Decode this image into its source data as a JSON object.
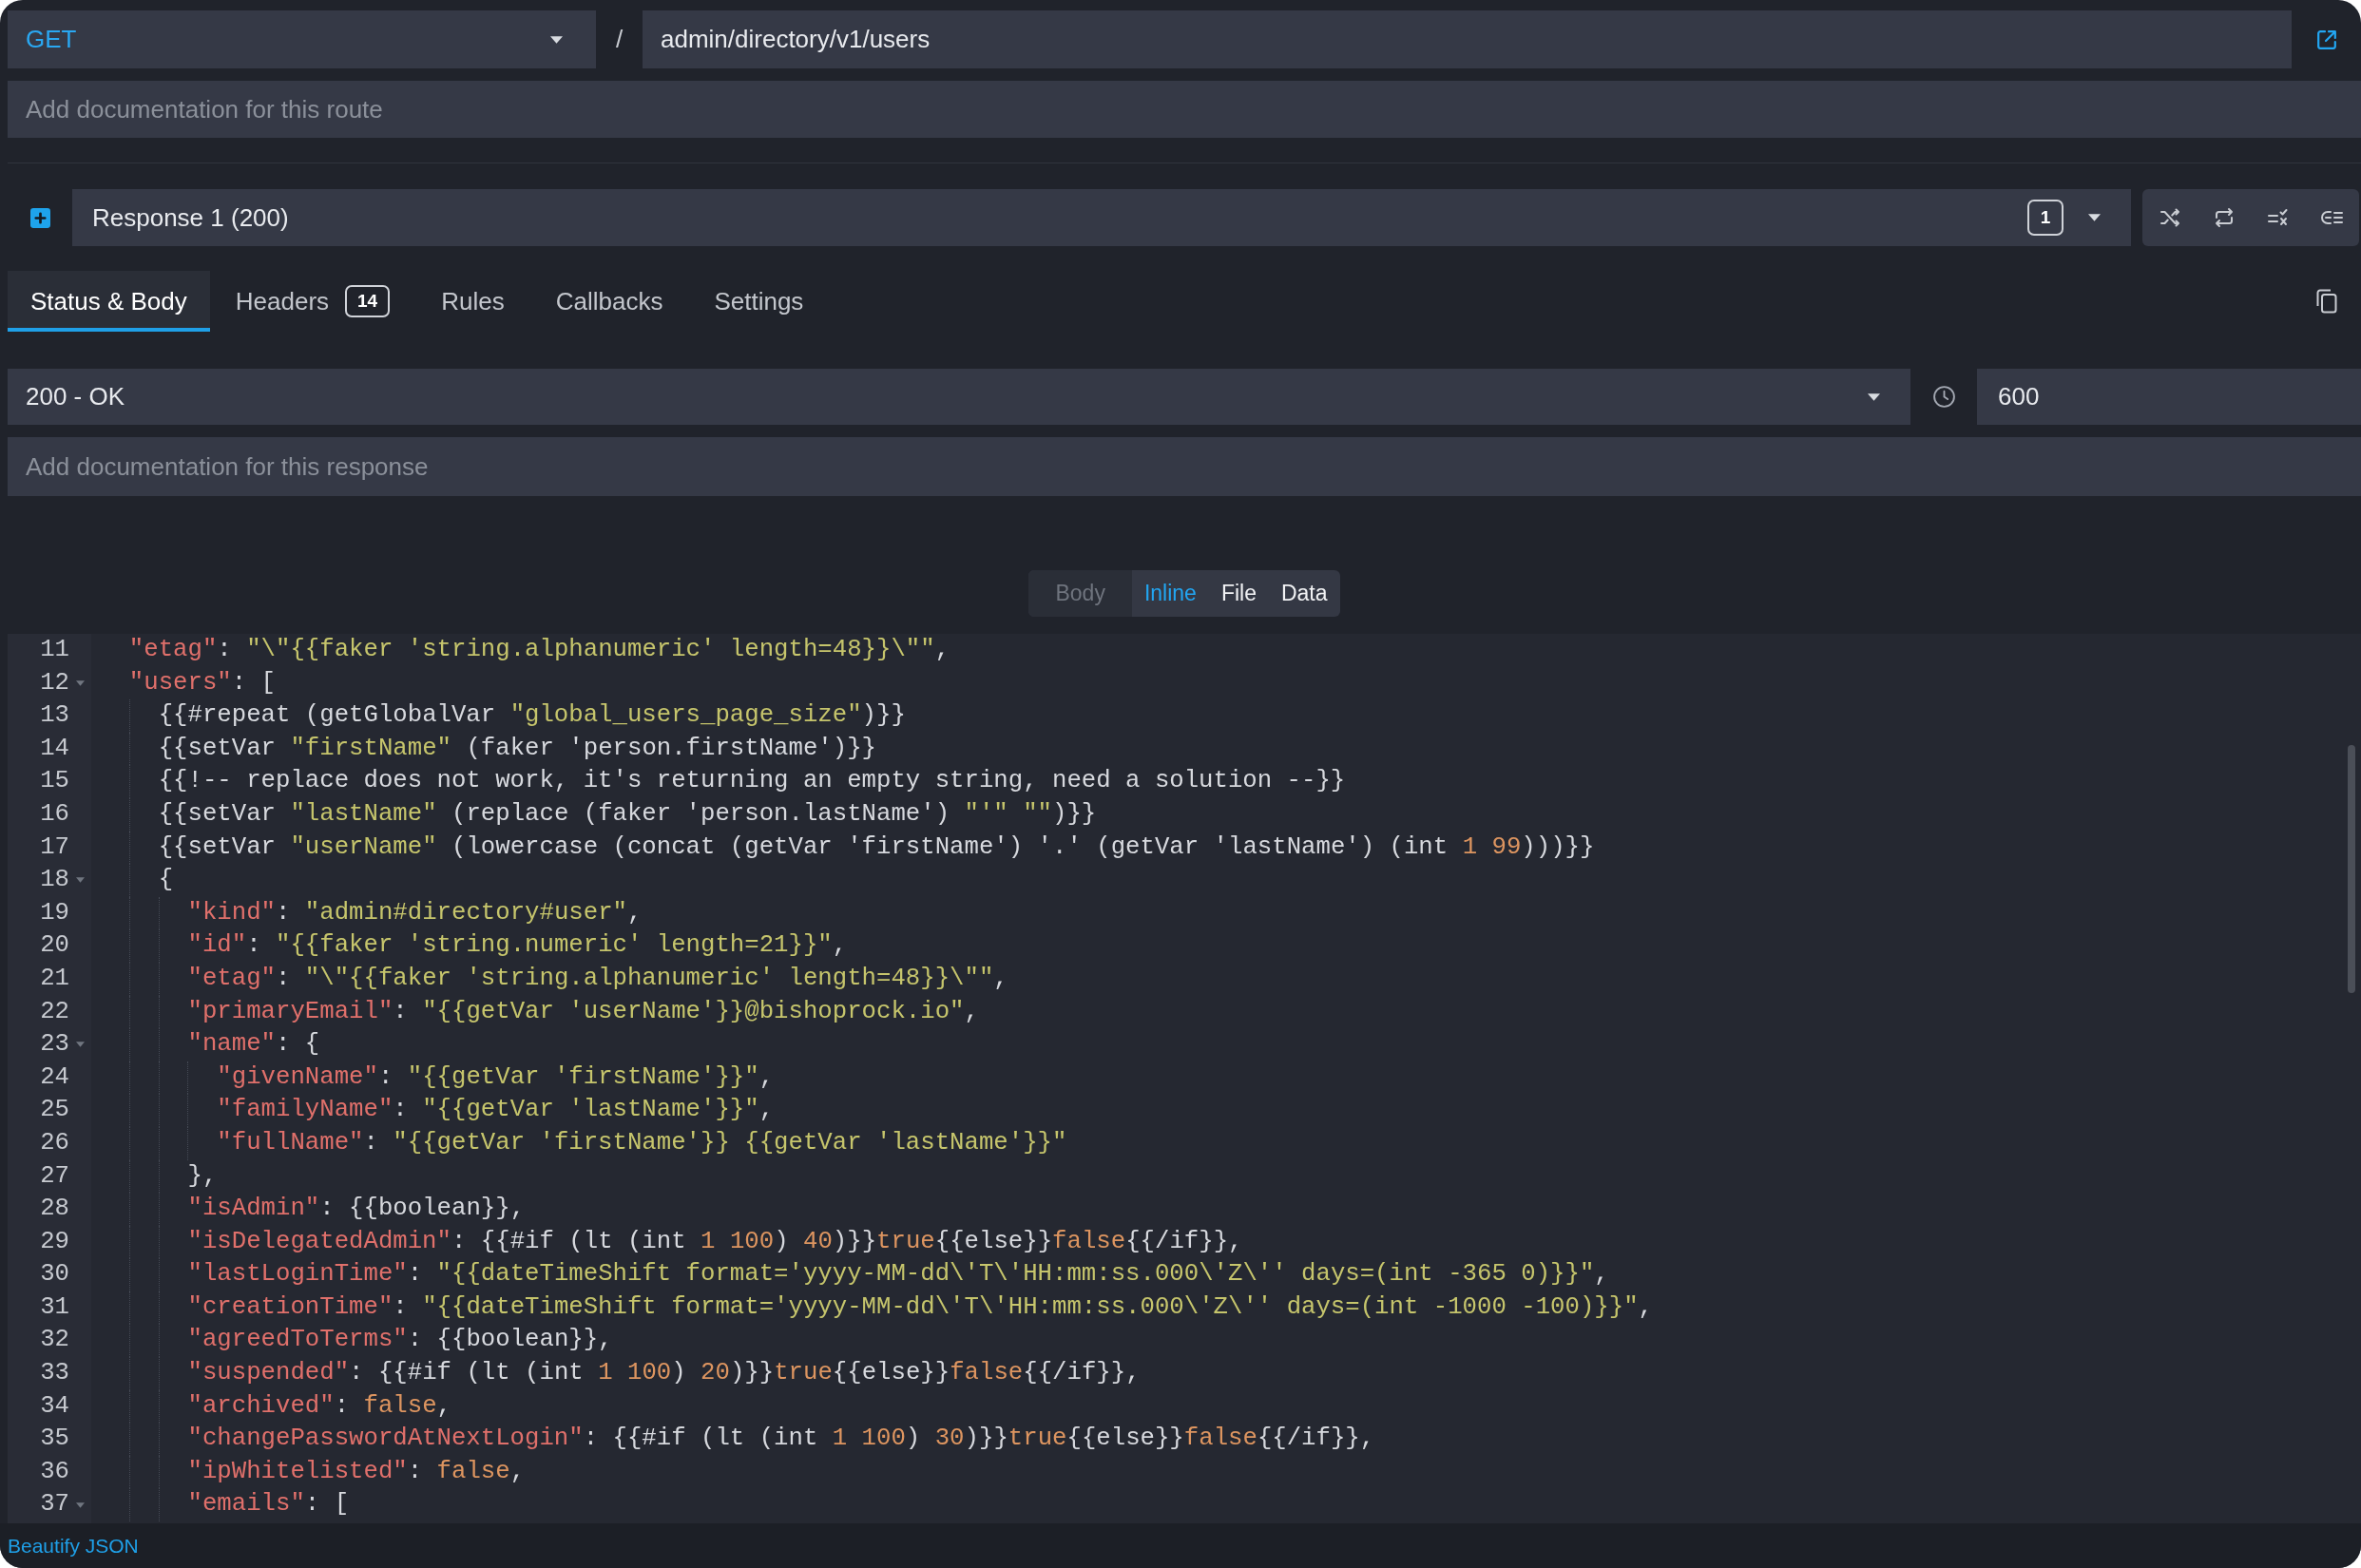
{
  "route": {
    "method": "GET",
    "separator": "/",
    "path": "admin/directory/v1/users",
    "documentation": {
      "placeholder": "Add documentation for this route"
    }
  },
  "response_selector": {
    "label": "Response 1 (200)",
    "badge": "1"
  },
  "tabs": [
    {
      "label": "Status & Body",
      "selected": true
    },
    {
      "label": "Headers",
      "badge": "14",
      "selected": false
    },
    {
      "label": "Rules",
      "selected": false
    },
    {
      "label": "Callbacks",
      "selected": false
    },
    {
      "label": "Settings",
      "selected": false
    }
  ],
  "status": {
    "code": "200 - OK",
    "latency": "600",
    "documentation": {
      "placeholder": "Add documentation for this response"
    }
  },
  "body_type": {
    "label": "Body",
    "options": [
      {
        "label": "Inline",
        "selected": true
      },
      {
        "label": "File",
        "selected": false
      },
      {
        "label": "Data",
        "selected": false
      }
    ]
  },
  "editor": {
    "lines": [
      {
        "number": "11",
        "code": "  \"etag\": \"\\\"{{faker 'string.alphanumeric' length=48}}\\\"\",",
        "foldable": false
      },
      {
        "number": "12",
        "code": "  \"users\": [",
        "foldable": true
      },
      {
        "number": "13",
        "code": "    {{#repeat (getGlobalVar \"global_users_page_size\")}}",
        "foldable": false
      },
      {
        "number": "14",
        "code": "    {{setVar \"firstName\" (faker 'person.firstName')}}",
        "foldable": false
      },
      {
        "number": "15",
        "code": "    {{!-- replace does not work, it's returning an empty string, need a solution --}}",
        "foldable": false
      },
      {
        "number": "16",
        "code": "    {{setVar \"lastName\" (replace (faker 'person.lastName') \"'\" \"\")}}",
        "foldable": false
      },
      {
        "number": "17",
        "code": "    {{setVar \"userName\" (lowercase (concat (getVar 'firstName') '.' (getVar 'lastName') (int 1 99)))}}",
        "foldable": false
      },
      {
        "number": "18",
        "code": "    {",
        "foldable": true
      },
      {
        "number": "19",
        "code": "      \"kind\": \"admin#directory#user\",",
        "foldable": false
      },
      {
        "number": "20",
        "code": "      \"id\": \"{{faker 'string.numeric' length=21}}\",",
        "foldable": false
      },
      {
        "number": "21",
        "code": "      \"etag\": \"\\\"{{faker 'string.alphanumeric' length=48}}\\\"\",",
        "foldable": false
      },
      {
        "number": "22",
        "code": "      \"primaryEmail\": \"{{getVar 'userName'}}@bishoprock.io\",",
        "foldable": false
      },
      {
        "number": "23",
        "code": "      \"name\": {",
        "foldable": true
      },
      {
        "number": "24",
        "code": "        \"givenName\": \"{{getVar 'firstName'}}\",",
        "foldable": false
      },
      {
        "number": "25",
        "code": "        \"familyName\": \"{{getVar 'lastName'}}\",",
        "foldable": false
      },
      {
        "number": "26",
        "code": "        \"fullName\": \"{{getVar 'firstName'}} {{getVar 'lastName'}}\"",
        "foldable": false
      },
      {
        "number": "27",
        "code": "      },",
        "foldable": false
      },
      {
        "number": "28",
        "code": "      \"isAdmin\": {{boolean}},",
        "foldable": false
      },
      {
        "number": "29",
        "code": "      \"isDelegatedAdmin\": {{#if (lt (int 1 100) 40)}}true{{else}}false{{/if}},",
        "foldable": false
      },
      {
        "number": "30",
        "code": "      \"lastLoginTime\": \"{{dateTimeShift format='yyyy-MM-dd\\'T\\'HH:mm:ss.000\\'Z\\'' days=(int -365 0)}}\",",
        "foldable": false
      },
      {
        "number": "31",
        "code": "      \"creationTime\": \"{{dateTimeShift format='yyyy-MM-dd\\'T\\'HH:mm:ss.000\\'Z\\'' days=(int -1000 -100)}}\",",
        "foldable": false
      },
      {
        "number": "32",
        "code": "      \"agreedToTerms\": {{boolean}},",
        "foldable": false
      },
      {
        "number": "33",
        "code": "      \"suspended\": {{#if (lt (int 1 100) 20)}}true{{else}}false{{/if}},",
        "foldable": false
      },
      {
        "number": "34",
        "code": "      \"archived\": false,",
        "foldable": false
      },
      {
        "number": "35",
        "code": "      \"changePasswordAtNextLogin\": {{#if (lt (int 1 100) 30)}}true{{else}}false{{/if}},",
        "foldable": false
      },
      {
        "number": "36",
        "code": "      \"ipWhitelisted\": false,",
        "foldable": false
      },
      {
        "number": "37",
        "code": "      \"emails\": [",
        "foldable": true
      }
    ]
  },
  "footer": {
    "link": "Beautify JSON"
  }
}
